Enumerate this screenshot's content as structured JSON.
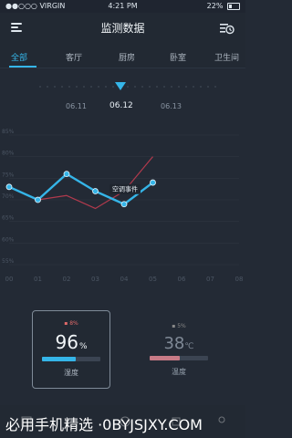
{
  "status_bar": {
    "carrier": "●●○○○ VIRGIN",
    "time": "4:21 PM",
    "battery": "22%"
  },
  "navbar": {
    "title": "监测数据"
  },
  "tabs": [
    {
      "label": "全部",
      "active": true
    },
    {
      "label": "客厅",
      "active": false
    },
    {
      "label": "厨房",
      "active": false
    },
    {
      "label": "卧室",
      "active": false
    },
    {
      "label": "卫生间",
      "active": false
    }
  ],
  "timeline": {
    "dates": [
      "06.11",
      "06.12",
      "06.13"
    ],
    "selected": "06.12"
  },
  "chart_data": {
    "type": "line",
    "y_tick_labels": [
      "85%",
      "80%",
      "75%",
      "70%",
      "65%",
      "60%",
      "55%"
    ],
    "x_tick_labels": [
      "00",
      "01",
      "02",
      "03",
      "04",
      "05",
      "06",
      "07",
      "08"
    ],
    "annotation": "空调事件",
    "series": [
      {
        "color": "#35b5e8",
        "x": [
          "00",
          "01",
          "02",
          "03",
          "04",
          "05"
        ],
        "values": [
          73,
          70,
          76,
          72,
          69,
          74
        ]
      },
      {
        "color": "#b13a4d",
        "x": [
          "00",
          "01",
          "02",
          "03",
          "04",
          "05"
        ],
        "values": [
          73,
          70,
          71,
          68,
          72,
          80
        ]
      }
    ]
  },
  "cards": {
    "humidity": {
      "small": "▪ 8%",
      "value": "96",
      "unit": "%",
      "label": "湿度",
      "fill_fraction": 0.58
    },
    "temperature": {
      "small": "▪ 5%",
      "value": "38",
      "unit": "℃",
      "label": "温度",
      "fill_fraction": 0.52
    }
  },
  "watermark": "必用手机精选 ·0BYJSJXY.COM"
}
